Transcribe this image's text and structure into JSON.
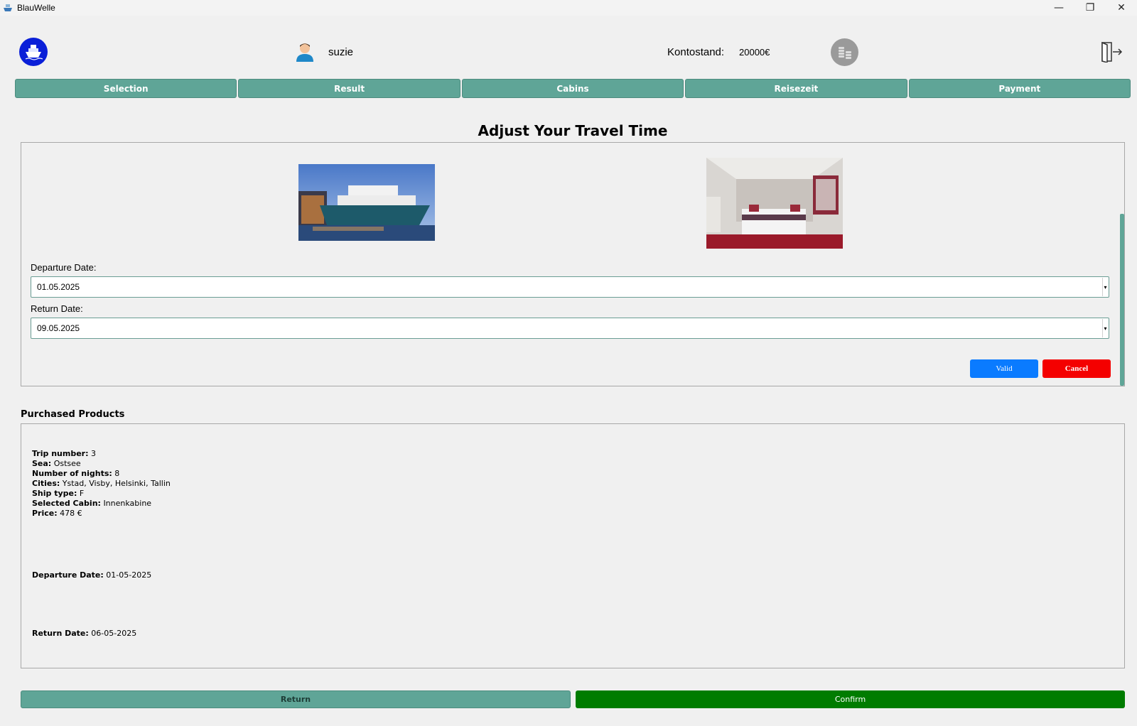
{
  "window": {
    "title": "BlauWelle",
    "minimize_icon": "—",
    "maximize_icon": "❐",
    "close_icon": "✕"
  },
  "header": {
    "username": "suzie",
    "balance_label": "Kontostand:",
    "balance_value": "20000€"
  },
  "tabs": [
    {
      "label": "Selection"
    },
    {
      "label": "Result"
    },
    {
      "label": "Cabins"
    },
    {
      "label": "Reisezeit"
    },
    {
      "label": "Payment"
    }
  ],
  "travel_time": {
    "heading": "Adjust Your Travel Time",
    "departure_label": "Departure Date:",
    "departure_value": "01.05.2025",
    "return_label": "Return Date:",
    "return_value": "09.05.2025",
    "valid_label": "Valid",
    "cancel_label": "Cancel"
  },
  "purchased": {
    "title": "Purchased Products",
    "trip_number_label": "Trip number:",
    "trip_number": "3",
    "sea_label": "Sea:",
    "sea": "Ostsee",
    "nights_label": "Number of nights:",
    "nights": "8",
    "cities_label": "Cities:",
    "cities": "Ystad, Visby, Helsinki, Tallin",
    "ship_type_label": "Ship type:",
    "ship_type": "F",
    "cabin_label": "Selected Cabin:",
    "cabin": "Innenkabine",
    "price_label": "Price:",
    "price": "478 €",
    "departure_label": "Departure Date:",
    "departure": "01-05-2025",
    "return_label": "Return Date:",
    "return": "06-05-2025"
  },
  "footer": {
    "return_label": "Return",
    "confirm_label": "Confirm"
  },
  "colors": {
    "tab": "#5fa597",
    "valid": "#0a7bff",
    "cancel": "#f40000",
    "confirm": "#007c00",
    "logo": "#0a1fd8"
  },
  "icons": {
    "app": "ship-icon",
    "user": "user-avatar-icon",
    "coins": "coins-icon",
    "logout": "logout-icon"
  }
}
